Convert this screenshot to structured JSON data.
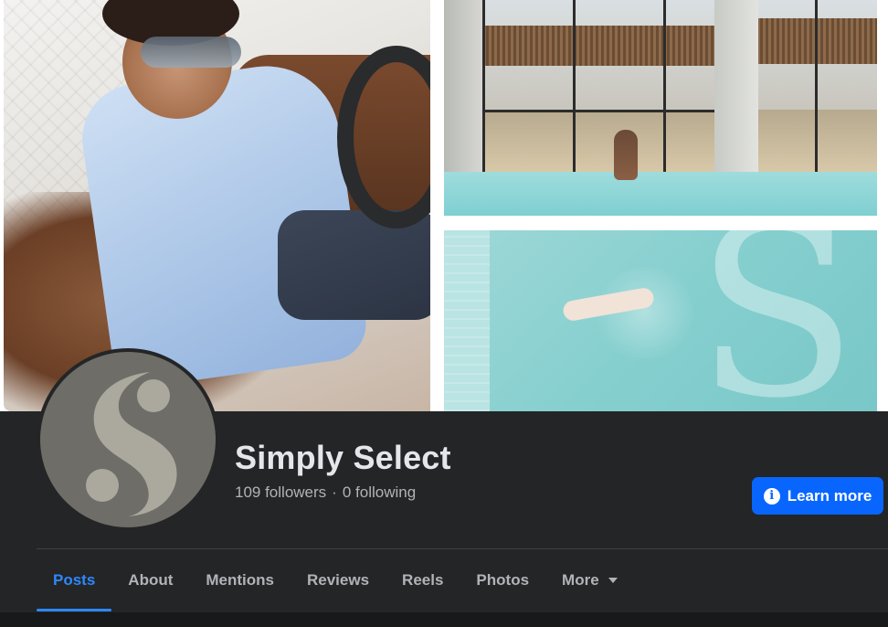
{
  "page": {
    "name": "Simply Select",
    "followers": "109 followers",
    "separator": "·",
    "following": "0 following"
  },
  "actions": {
    "learn_more_label": "Learn more",
    "learn_more_icon": "info-icon"
  },
  "tabs": [
    {
      "label": "Posts",
      "active": true
    },
    {
      "label": "About",
      "active": false
    },
    {
      "label": "Mentions",
      "active": false
    },
    {
      "label": "Reviews",
      "active": false
    },
    {
      "label": "Reels",
      "active": false
    },
    {
      "label": "Photos",
      "active": false
    },
    {
      "label": "More",
      "active": false,
      "icon": "caret-down-icon"
    }
  ],
  "colors": {
    "background": "#242526",
    "accent": "#2d88ff",
    "button": "#0866ff",
    "avatar_bg": "#6f6d68",
    "avatar_logo": "#aba89e"
  }
}
